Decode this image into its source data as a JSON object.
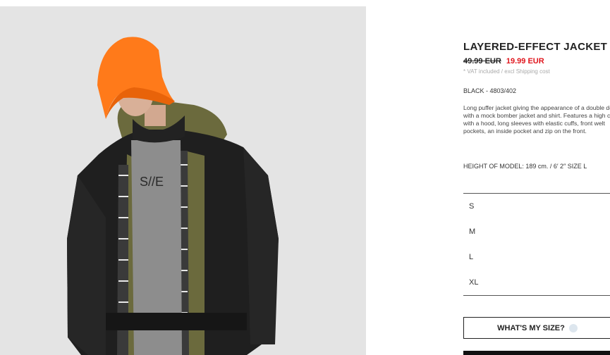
{
  "product": {
    "title": "LAYERED-EFFECT JACKET",
    "old_price": "49.99 EUR",
    "new_price": "19.99 EUR",
    "vat_note": "* VAT included / excl Shipping cost",
    "color_ref": "BLACK - 4803/402",
    "description": "Long puffer jacket giving the appearance of a double design with a mock bomber jacket and shirt. Features a high collar with a hood, long sleeves with elastic cuffs, front welt pockets, an inside pocket and zip on the front.",
    "model_info": "HEIGHT OF MODEL: 189 cm. / 6′ 2″ SIZE L"
  },
  "sizes": [
    "S",
    "M",
    "L",
    "XL"
  ],
  "size_help": {
    "label": "WHAT'S MY SIZE?",
    "icon": "help-icon"
  },
  "photo": {
    "shirt_print": "S//E",
    "alt": "model in orange bucket hat and layered jacket"
  },
  "colors": {
    "sale_price": "#e0151c",
    "hat": "#ff7a1a",
    "jacket": "#1f1f1f",
    "lining": "#6b6a3d"
  }
}
